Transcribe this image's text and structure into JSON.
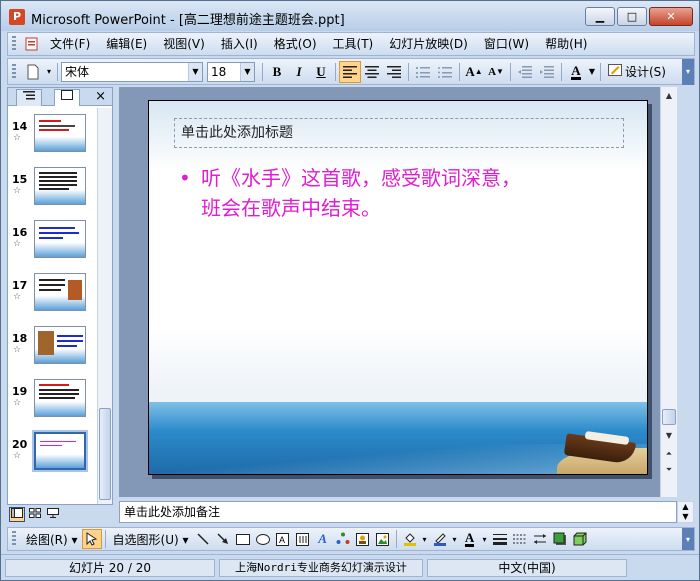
{
  "window": {
    "title": "Microsoft PowerPoint - [高二理想前途主题班会.ppt]",
    "app_icon_letter": "P",
    "minimize_label": "▁",
    "maximize_label": "□",
    "close_label": "✕"
  },
  "menu": {
    "items": [
      "文件(F)",
      "编辑(E)",
      "视图(V)",
      "插入(I)",
      "格式(O)",
      "工具(T)",
      "幻灯片放映(D)",
      "窗口(W)",
      "帮助(H)"
    ]
  },
  "format_toolbar": {
    "font_name": "宋体",
    "font_size": "18",
    "bold": "B",
    "italic": "I",
    "underline": "U",
    "design_label": "设计(S)"
  },
  "slides_pane": {
    "thumbnails": [
      {
        "number": "14"
      },
      {
        "number": "15"
      },
      {
        "number": "16"
      },
      {
        "number": "17"
      },
      {
        "number": "18"
      },
      {
        "number": "19"
      },
      {
        "number": "20",
        "selected": true
      }
    ],
    "close_label": "×"
  },
  "slide": {
    "title_placeholder": "单击此处添加标题",
    "bullet": "•",
    "body_lines": [
      "听《水手》这首歌，感受歌词深意，",
      "班会在歌声中结束。"
    ],
    "body_color": "#e01ed0"
  },
  "notes": {
    "placeholder": "单击此处添加备注"
  },
  "draw_toolbar": {
    "draw_label": "绘图(R)",
    "autoshapes_label": "自选图形(U)"
  },
  "status": {
    "slide_position": "幻灯片 20 / 20",
    "design_template": "上海Nordri专业商务幻灯演示设计",
    "language": "中文(中国)"
  }
}
